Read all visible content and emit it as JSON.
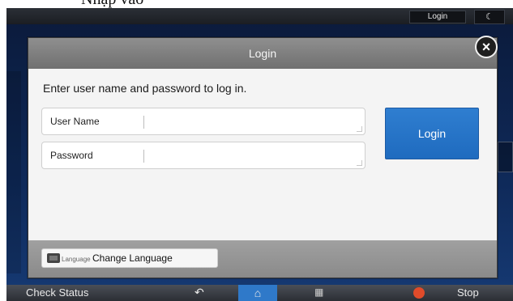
{
  "caption": "Nhập vào",
  "topbar": {
    "login_label": "Login",
    "moon_icon": "moon-icon"
  },
  "dialog": {
    "title": "Login",
    "instruction": "Enter user name and password to log in.",
    "fields": [
      {
        "label": "User Name",
        "value": ""
      },
      {
        "label": "Password",
        "value": ""
      }
    ],
    "login_button": "Login",
    "close_icon": "close-icon"
  },
  "footer": {
    "language_small": "Language",
    "language_button": "Change Language",
    "keyboard_icon": "keyboard-icon"
  },
  "bottombar": {
    "check_status": "Check Status",
    "back_icon": "↶",
    "home_icon": "⌂",
    "menu_icon": "▦",
    "stop": "Stop"
  },
  "colors": {
    "primary_blue": "#1f6bbf",
    "dialog_header": "#7a7a7a",
    "stop_red": "#e04b2a"
  }
}
